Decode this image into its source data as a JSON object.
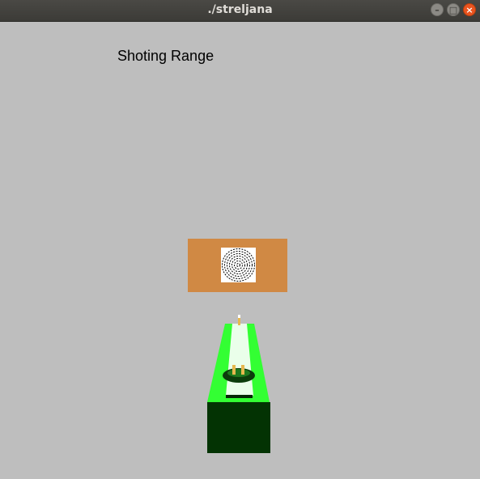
{
  "window": {
    "title": "./streljana",
    "controls": {
      "minimize": {
        "icon": "minimize-icon",
        "glyph": "–"
      },
      "maximize": {
        "icon": "maximize-icon",
        "glyph": "□"
      },
      "close": {
        "icon": "close-icon",
        "glyph": "×"
      }
    }
  },
  "game": {
    "heading": "Shoting Range",
    "colors": {
      "background": "#bebebe",
      "target_board": "#d08944",
      "target_face": "#ffffff",
      "lane_top": "#33ff33",
      "lane_front": "#033303",
      "lane_strip": "#eaffea",
      "gun_barrel": "#e6b84e",
      "bullet": "#ffffff"
    }
  }
}
